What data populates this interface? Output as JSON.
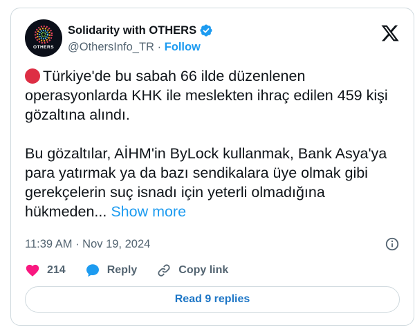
{
  "account": {
    "display_name": "Solidarity with OTHERS",
    "handle": "@OthersInfo_TR",
    "separator": "·",
    "follow_label": "Follow",
    "avatar_text": "OTHERS",
    "verified": true
  },
  "tweet": {
    "paragraph1": "Türkiye'de bu sabah 66 ilde düzenlenen operasyonlarda KHK ile meslekten ihraç edilen 459 kişi gözaltına alındı.",
    "paragraph2": "Bu gözaltılar, AİHM'in ByLock kullanmak, Bank Asya'ya para yatırmak ya da bazı sendikalara üye olmak gibi gerekçelerin suç isnadı için yeterli olmadığına hükmeden...",
    "show_more_label": "Show more",
    "timestamp": "11:39 AM · Nov 19, 2024"
  },
  "actions": {
    "likes_count": "214",
    "reply_label": "Reply",
    "copy_link_label": "Copy link",
    "read_replies_label": "Read 9 replies"
  },
  "icons": {
    "brand_logo": "x-logo-icon",
    "verified": "verified-badge-icon",
    "info": "info-icon",
    "like": "heart-icon",
    "reply": "reply-bubble-icon",
    "copy": "link-icon"
  },
  "colors": {
    "accent": "#1d9bf0",
    "like": "#f91880",
    "red_circle": "#dd2e44",
    "muted_text": "#536471",
    "border": "#cfd9de"
  }
}
